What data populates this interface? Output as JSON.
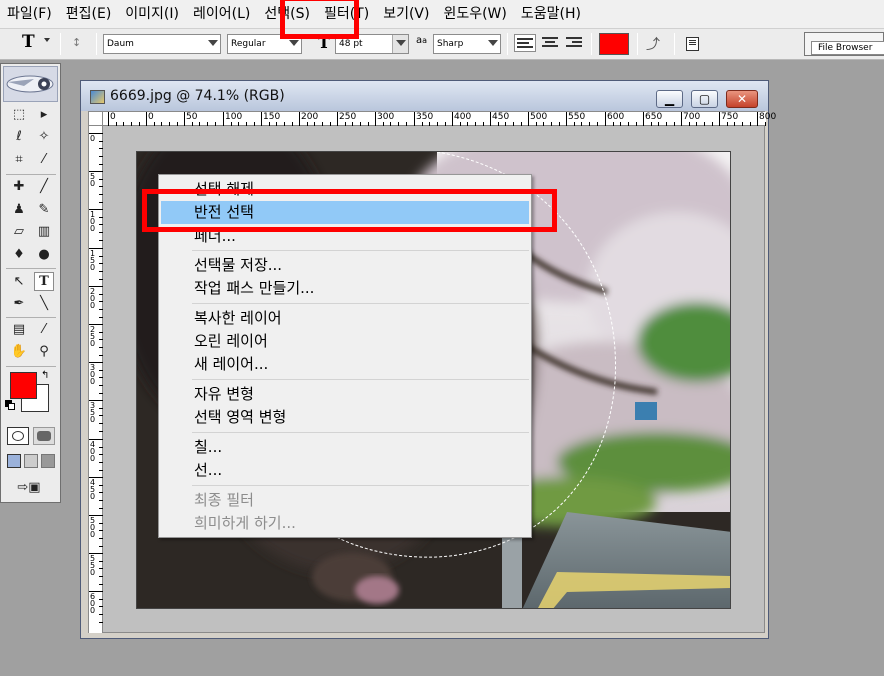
{
  "menubar": {
    "items": [
      "파일(F)",
      "편집(E)",
      "이미지(I)",
      "레이어(L)",
      "선택(S)",
      "필터(T)",
      "보기(V)",
      "윈도우(W)",
      "도움말(H)"
    ]
  },
  "options": {
    "tool_glyph": "T",
    "font_family": "Daum",
    "font_style": "Regular",
    "font_size": "48 pt",
    "aa_label": "a",
    "aa_sub": "a",
    "antialias": "Sharp",
    "color": "#ff0000",
    "file_browser": "File Browser"
  },
  "document": {
    "title": "6669.jpg @ 74.1% (RGB)",
    "ruler_h": [
      "0",
      "0",
      "50",
      "100",
      "150",
      "200",
      "250",
      "300",
      "350",
      "400",
      "450",
      "500",
      "550",
      "600",
      "650",
      "700",
      "750",
      "800"
    ],
    "ruler_v": [
      "0",
      "5 0",
      "1 0 0",
      "1 5 0",
      "2 0 0",
      "2 5 0",
      "3 0 0",
      "3 5 0",
      "4 0 0",
      "4 5 0",
      "5 0 0",
      "5 5 0",
      "6 0 0"
    ]
  },
  "context_menu": {
    "items": [
      {
        "label": "선택 해제",
        "disabled": false
      },
      {
        "label": "반전 선택",
        "disabled": false,
        "highlighted": true
      },
      {
        "label": "페더...",
        "disabled": false
      },
      {
        "label": "선택물 저장...",
        "disabled": false
      },
      {
        "label": "작업 패스 만들기...",
        "disabled": false
      },
      {
        "label": "복사한 레이어",
        "disabled": false
      },
      {
        "label": "오린 레이어",
        "disabled": false
      },
      {
        "label": "새 레이어...",
        "disabled": false
      },
      {
        "label": "자유 변형",
        "disabled": false
      },
      {
        "label": "선택 영역 변형",
        "disabled": false
      },
      {
        "label": "칠...",
        "disabled": false
      },
      {
        "label": "선...",
        "disabled": false
      },
      {
        "label": "최종 필터",
        "disabled": true
      },
      {
        "label": "희미하게 하기...",
        "disabled": true
      }
    ]
  },
  "colors": {
    "foreground": "#ff0000",
    "background": "#ffffff",
    "annotation": "#ff0000",
    "highlight": "#91c9f7"
  }
}
